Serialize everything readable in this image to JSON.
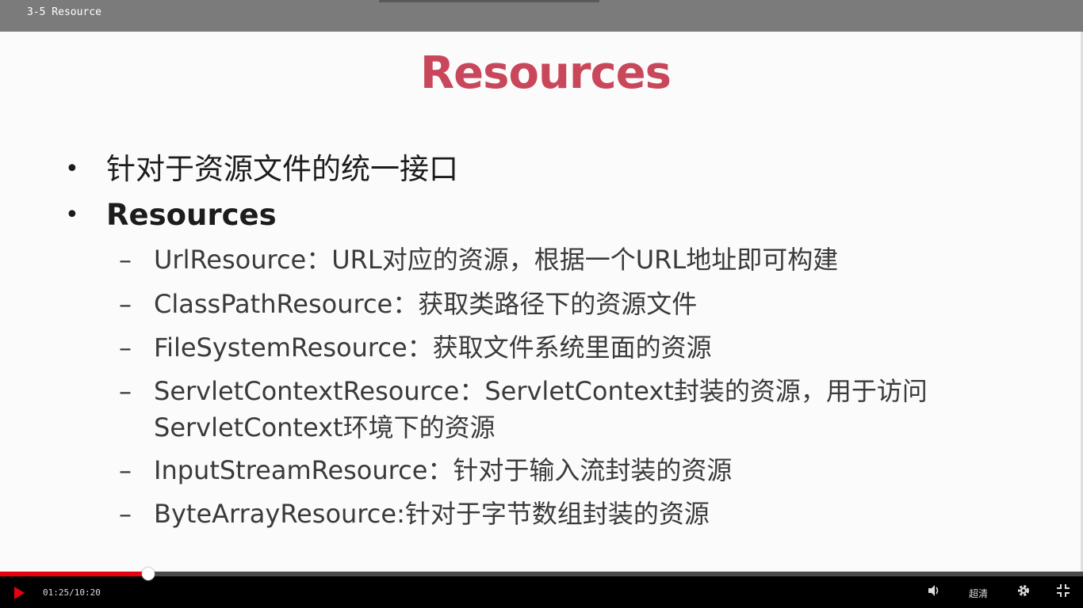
{
  "window": {
    "title": "3-5 Resource"
  },
  "slide": {
    "title": "Resources",
    "bullets": [
      {
        "text": "针对于资源文件的统一接口",
        "bold": false
      },
      {
        "text": "Resources",
        "bold": true
      }
    ],
    "sub_bullets": [
      "UrlResource：URL对应的资源，根据一个URL地址即可构建",
      "ClassPathResource：获取类路径下的资源文件",
      "FileSystemResource：获取文件系统里面的资源",
      "ServletContextResource：ServletContext封装的资源，用于访问ServletContext环境下的资源",
      "InputStreamResource：针对于输入流封装的资源",
      "ByteArrayResource:针对于字节数组封装的资源"
    ],
    "bullet_symbol": "•",
    "dash_symbol": "–"
  },
  "player": {
    "time": "01:25/10:20",
    "progress": 0.1369,
    "quality_label": "超清",
    "icons": [
      "play-icon",
      "volume-icon",
      "gear-icon",
      "exit-fullscreen-icon"
    ],
    "accent_color": "#e60012"
  }
}
